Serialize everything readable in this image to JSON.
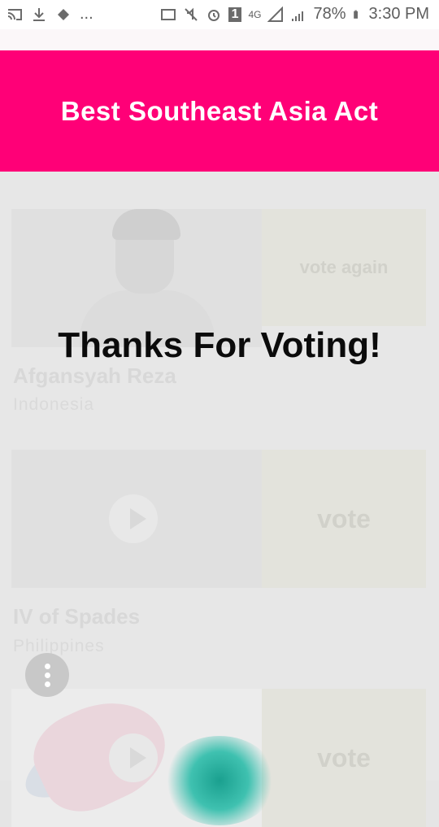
{
  "status_bar": {
    "battery": "78%",
    "time": "3:30 PM",
    "more": "...",
    "network": "4G",
    "sim": "1"
  },
  "header": {
    "title": "Best Southeast Asia Act"
  },
  "cards": [
    {
      "name": "Afgansyah Reza",
      "country": "Indonesia",
      "vote_label": "vote again"
    },
    {
      "name": "IV of Spades",
      "country": "Philippines",
      "vote_label": "vote"
    },
    {
      "name": "",
      "country": "",
      "vote_label": "vote"
    }
  ],
  "overlay": {
    "message": "Thanks For Voting!"
  },
  "colors": {
    "header": "#ff0077",
    "fab": "#c8c8c8",
    "glow": "#1aa08f"
  },
  "icons": [
    "cast-icon",
    "download-icon",
    "diamond-icon",
    "mute-icon",
    "alarm-icon",
    "signal-icon",
    "battery-icon",
    "menu-dots-icon",
    "play-icon"
  ]
}
